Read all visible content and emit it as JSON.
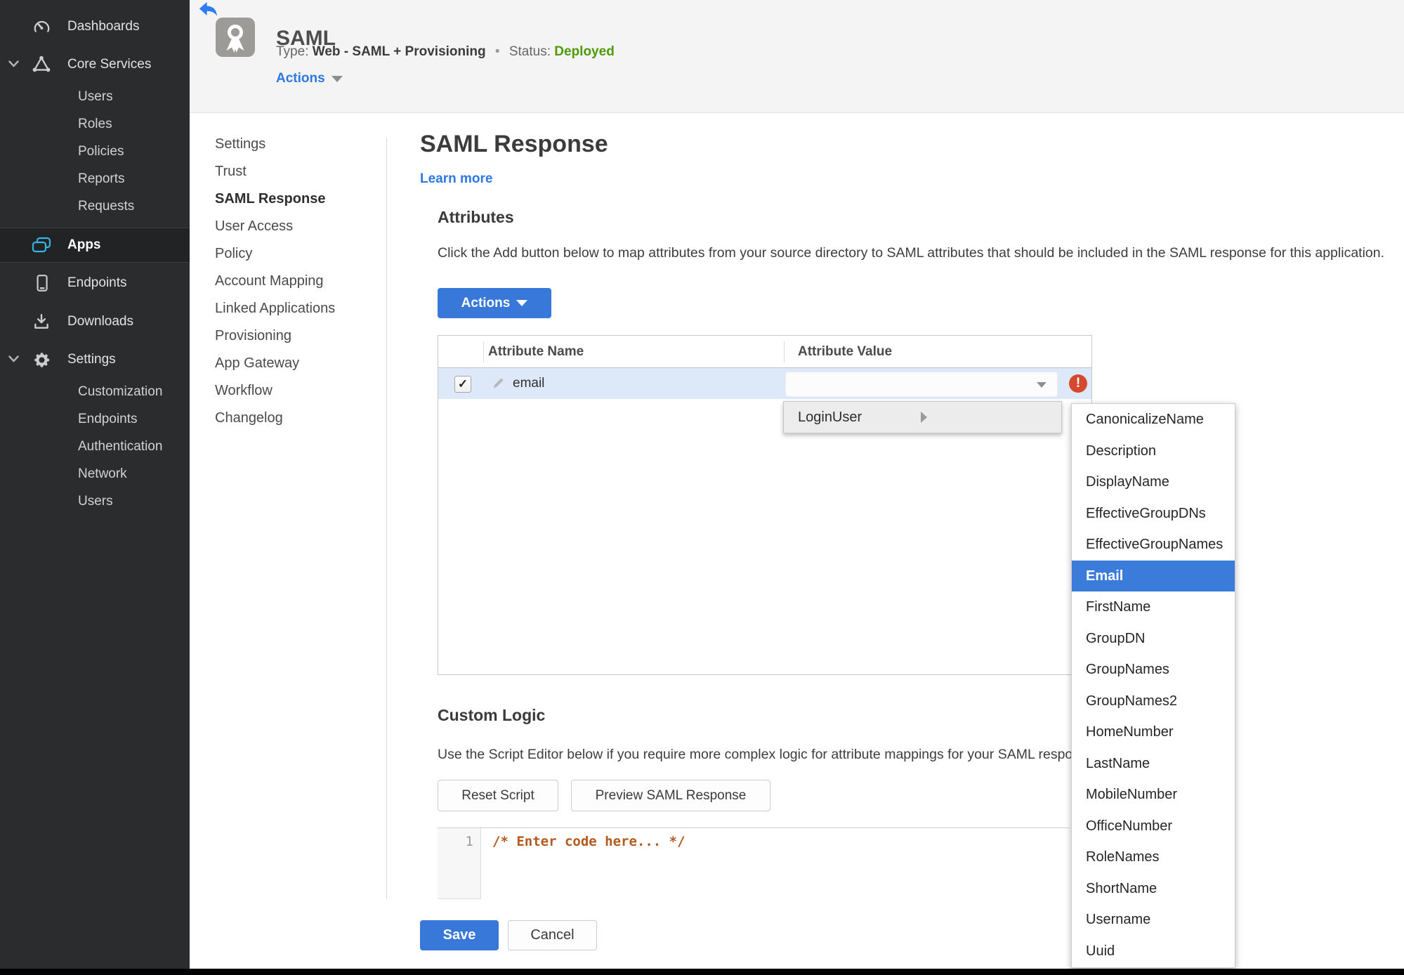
{
  "colors": {
    "accent_blue": "#3878d8",
    "link_blue": "#2d78e5",
    "status_green": "#4e9a06",
    "error_red": "#d6492f",
    "selected_blue": "#3b7cdb",
    "apps_cyan": "#35b5e5",
    "row_highlight": "#dde9f8",
    "code_comment": "#b35a1f"
  },
  "icons": {
    "back": "arrow-left",
    "app_badge": "award-ribbon",
    "dashboards": "gauge",
    "core_services": "triangle-nodes",
    "apps": "stacked-windows",
    "endpoints": "mobile-device",
    "downloads": "download-tray",
    "settings": "gear",
    "expand": "chevron-down",
    "row_edit": "pencil",
    "select_caret": "caret-down",
    "submenu_arrow": "caret-right",
    "error": "exclamation-circle",
    "checkbox_check": "✓",
    "error_glyph": "!"
  },
  "sidebar": {
    "dashboards": "Dashboards",
    "core_services": "Core Services",
    "core_children": [
      "Users",
      "Roles",
      "Policies",
      "Reports",
      "Requests"
    ],
    "apps": "Apps",
    "endpoints": "Endpoints",
    "downloads": "Downloads",
    "settings": "Settings",
    "settings_children": [
      "Customization",
      "Endpoints",
      "Authentication",
      "Network",
      "Users"
    ]
  },
  "header": {
    "app_name": "SAML",
    "type_label": "Type:",
    "type_value": "Web - SAML + Provisioning",
    "separator": "•",
    "status_label": "Status:",
    "status_value": "Deployed",
    "actions_label": "Actions"
  },
  "subnav": {
    "items": [
      {
        "label": "Settings"
      },
      {
        "label": "Trust"
      },
      {
        "label": "SAML Response",
        "active": true
      },
      {
        "label": "User Access"
      },
      {
        "label": "Policy"
      },
      {
        "label": "Account Mapping"
      },
      {
        "label": "Linked Applications"
      },
      {
        "label": "Provisioning"
      },
      {
        "label": "App Gateway"
      },
      {
        "label": "Workflow"
      },
      {
        "label": "Changelog"
      }
    ]
  },
  "page": {
    "title": "SAML Response",
    "learn_more": "Learn more",
    "attributes": {
      "heading": "Attributes",
      "description": "Click the Add button below to map attributes from your source directory to SAML attributes that should be included in the SAML response for this application.",
      "actions_button": "Actions",
      "table": {
        "columns": [
          "Attribute Name",
          "Attribute Value"
        ],
        "rows": [
          {
            "checked": true,
            "name": "email",
            "value": ""
          }
        ]
      }
    },
    "value_menu": {
      "root_item": "LoginUser",
      "selected_option": "Email",
      "options": [
        "CanonicalizeName",
        "Description",
        "DisplayName",
        "EffectiveGroupDNs",
        "EffectiveGroupNames",
        "Email",
        "FirstName",
        "GroupDN",
        "GroupNames",
        "GroupNames2",
        "HomeNumber",
        "LastName",
        "MobileNumber",
        "OfficeNumber",
        "RoleNames",
        "ShortName",
        "Username",
        "Uuid"
      ],
      "custom_logic": ""
    },
    "custom_logic": {
      "heading": "Custom Logic",
      "description": "Use the Script Editor below if you require more complex logic for attribute mappings for your SAML response.",
      "reset_button": "Reset Script",
      "preview_button": "Preview SAML Response",
      "editor": {
        "line_number": "1",
        "code": "/* Enter code here... */"
      }
    },
    "save_button": "Save",
    "cancel_button": "Cancel"
  }
}
